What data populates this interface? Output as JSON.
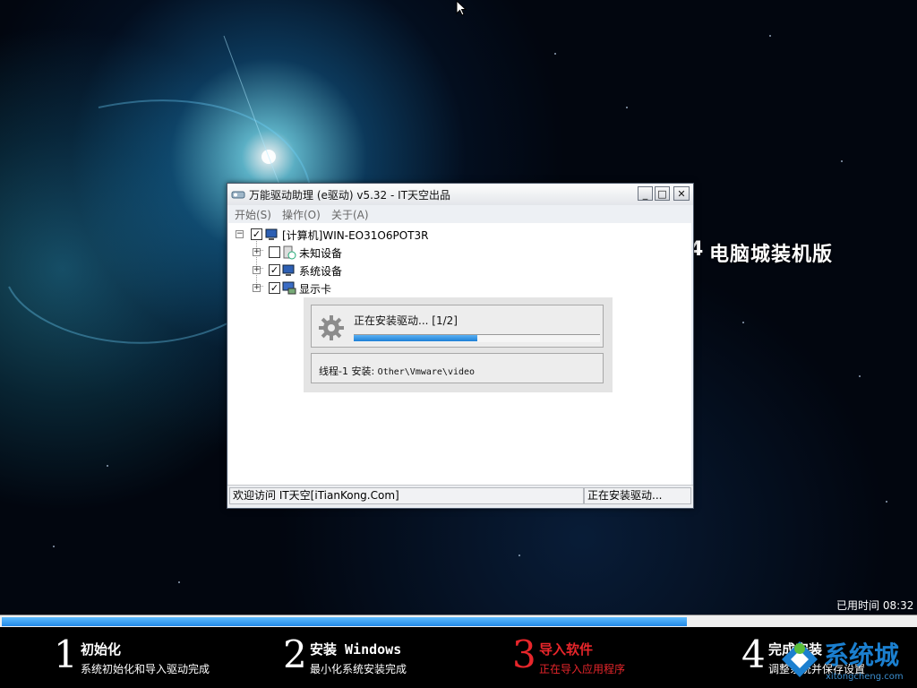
{
  "background": {
    "brand_prefix": "4",
    "brand_text": "电脑城装机版"
  },
  "window": {
    "title": "万能驱动助理 (e驱动) v5.32 - IT天空出品",
    "minimize_label": "_",
    "maximize_label": "□",
    "close_label": "✕",
    "menu": [
      "开始(S)",
      "操作(O)",
      "关于(A)"
    ],
    "tree": {
      "root": {
        "label": "[计算机]WIN-EO31O6POT3R",
        "checked": true
      },
      "children": [
        {
          "label": "未知设备",
          "checked": false,
          "icon": "unknown-device-icon"
        },
        {
          "label": "系统设备",
          "checked": true,
          "icon": "system-device-icon"
        },
        {
          "label": "显示卡",
          "checked": true,
          "icon": "display-adapter-icon"
        }
      ]
    },
    "progress": {
      "label": "正在安装驱动... [1/2]",
      "fraction": 0.5,
      "thread_prefix": "线程-1 安装:",
      "thread_path": "Other\\Vmware\\video"
    },
    "status": {
      "left": "欢迎访问 IT天空[iTianKong.Com]",
      "right": "正在安装驱动..."
    }
  },
  "installer": {
    "elapsed_label": "已用时间",
    "elapsed_time": "08:32",
    "progress_fraction": 0.75,
    "steps": [
      {
        "num": "1",
        "title": "初始化",
        "desc": "系统初始化和导入驱动完成",
        "color": "#ffffff",
        "active": false
      },
      {
        "num": "2",
        "title": "安装 Windows",
        "desc": "最小化系统安装完成",
        "color": "#ffffff",
        "active": false
      },
      {
        "num": "3",
        "title": "导入软件",
        "desc": "正在导入应用程序",
        "color": "#e8262b",
        "active": true
      },
      {
        "num": "4",
        "title": "完成安装",
        "desc": "调整系统并保存设置",
        "color": "#ffffff",
        "active": false
      }
    ]
  },
  "watermark": {
    "text": "系统城",
    "sub": "xitongcheng.com",
    "accent": "#1b7fcf"
  }
}
